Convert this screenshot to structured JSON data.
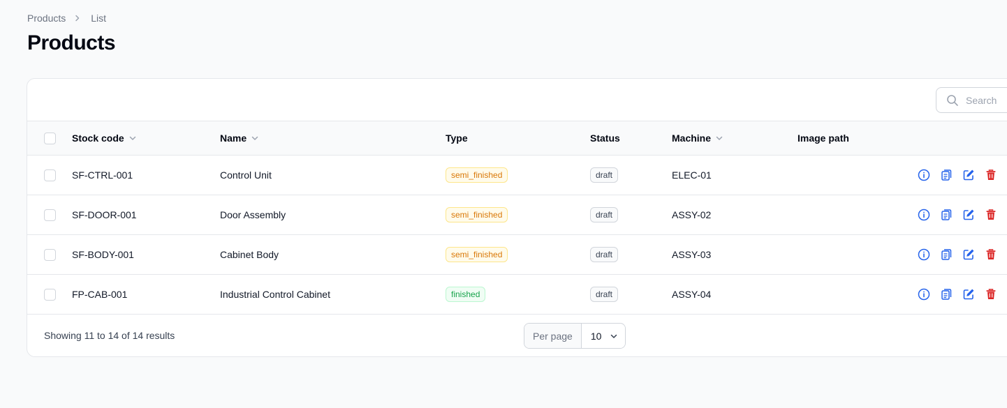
{
  "breadcrumb": {
    "root": "Products",
    "current": "List"
  },
  "page_title": "Products",
  "search": {
    "placeholder": "Search"
  },
  "table": {
    "columns": {
      "stock_code": "Stock code",
      "name": "Name",
      "type": "Type",
      "status": "Status",
      "machine": "Machine",
      "image_path": "Image path"
    },
    "rows": [
      {
        "stock_code": "SF-CTRL-001",
        "name": "Control Unit",
        "type": "semi_finished",
        "status": "draft",
        "machine": "ELEC-01"
      },
      {
        "stock_code": "SF-DOOR-001",
        "name": "Door Assembly",
        "type": "semi_finished",
        "status": "draft",
        "machine": "ASSY-02"
      },
      {
        "stock_code": "SF-BODY-001",
        "name": "Cabinet Body",
        "type": "semi_finished",
        "status": "draft",
        "machine": "ASSY-03"
      },
      {
        "stock_code": "FP-CAB-001",
        "name": "Industrial Control Cabinet",
        "type": "finished",
        "status": "draft",
        "machine": "ASSY-04"
      }
    ],
    "row_actions": [
      "info-icon",
      "clipboard-icon",
      "edit-icon",
      "trash-icon"
    ]
  },
  "footer": {
    "summary": "Showing 11 to 14 of 14 results",
    "per_page_label": "Per page",
    "per_page_value": "10"
  },
  "colors": {
    "accent_blue": "#2563eb",
    "danger_red": "#dc2626",
    "warning_orange": "#d97706",
    "success_green": "#16a34a"
  }
}
